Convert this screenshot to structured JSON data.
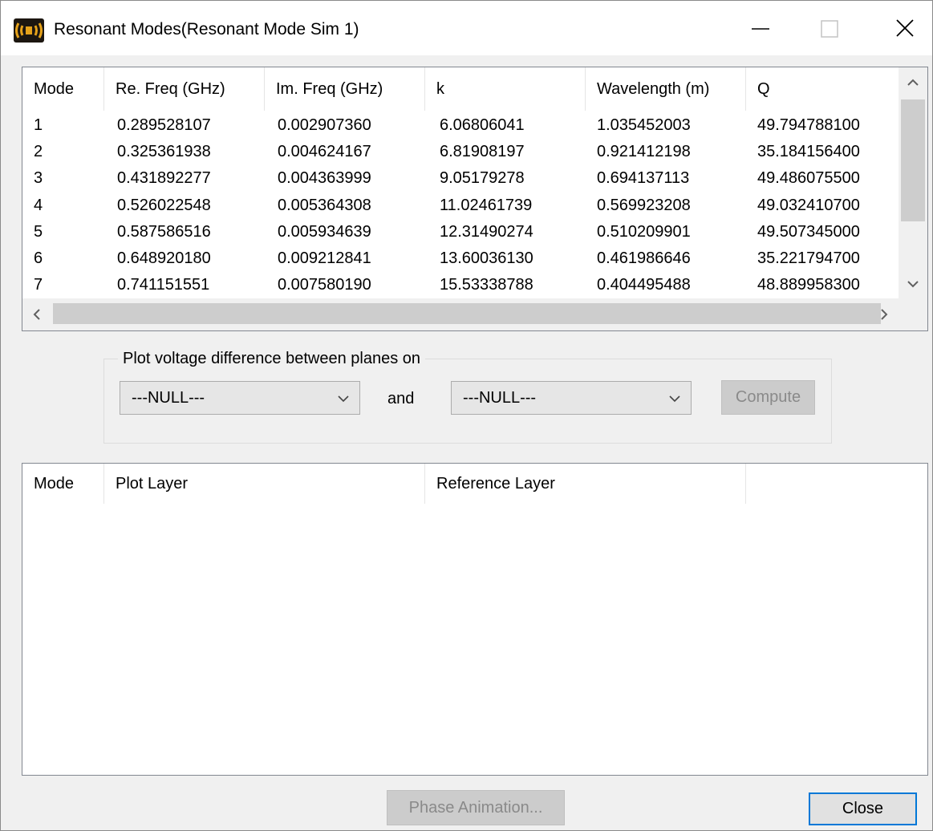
{
  "window": {
    "title": "Resonant Modes(Resonant Mode Sim 1)",
    "icon": "resonance-app-icon",
    "controls": [
      "minimize-icon",
      "maximize-icon",
      "close-icon"
    ]
  },
  "modes_table": {
    "columns": [
      "Mode",
      "Re. Freq (GHz)",
      "Im. Freq (GHz)",
      "k",
      "Wavelength (m)",
      "Q"
    ],
    "rows": [
      [
        "1",
        "0.289528107",
        "0.002907360",
        "6.06806041",
        "1.035452003",
        "49.794788100"
      ],
      [
        "2",
        "0.325361938",
        "0.004624167",
        "6.81908197",
        "0.921412198",
        "35.184156400"
      ],
      [
        "3",
        "0.431892277",
        "0.004363999",
        "9.05179278",
        "0.694137113",
        "49.486075500"
      ],
      [
        "4",
        "0.526022548",
        "0.005364308",
        "11.02461739",
        "0.569923208",
        "49.032410700"
      ],
      [
        "5",
        "0.587586516",
        "0.005934639",
        "12.31490274",
        "0.510209901",
        "49.507345000"
      ],
      [
        "6",
        "0.648920180",
        "0.009212841",
        "13.60036130",
        "0.461986646",
        "35.221794700"
      ],
      [
        "7",
        "0.741151551",
        "0.007580190",
        "15.53338788",
        "0.404495488",
        "48.889958300"
      ]
    ]
  },
  "plot_group": {
    "title": "Plot voltage difference between planes on",
    "plane1": "---NULL---",
    "and_label": "and",
    "plane2": "---NULL---",
    "compute_label": "Compute"
  },
  "plot_table": {
    "columns": [
      "Mode",
      "Plot Layer",
      "Reference Layer"
    ]
  },
  "footer": {
    "phase_animation_label": "Phase Animation...",
    "close_label": "Close"
  },
  "colors": {
    "accent_border": "#0078d7",
    "disabled_text": "#8a8a8a"
  }
}
